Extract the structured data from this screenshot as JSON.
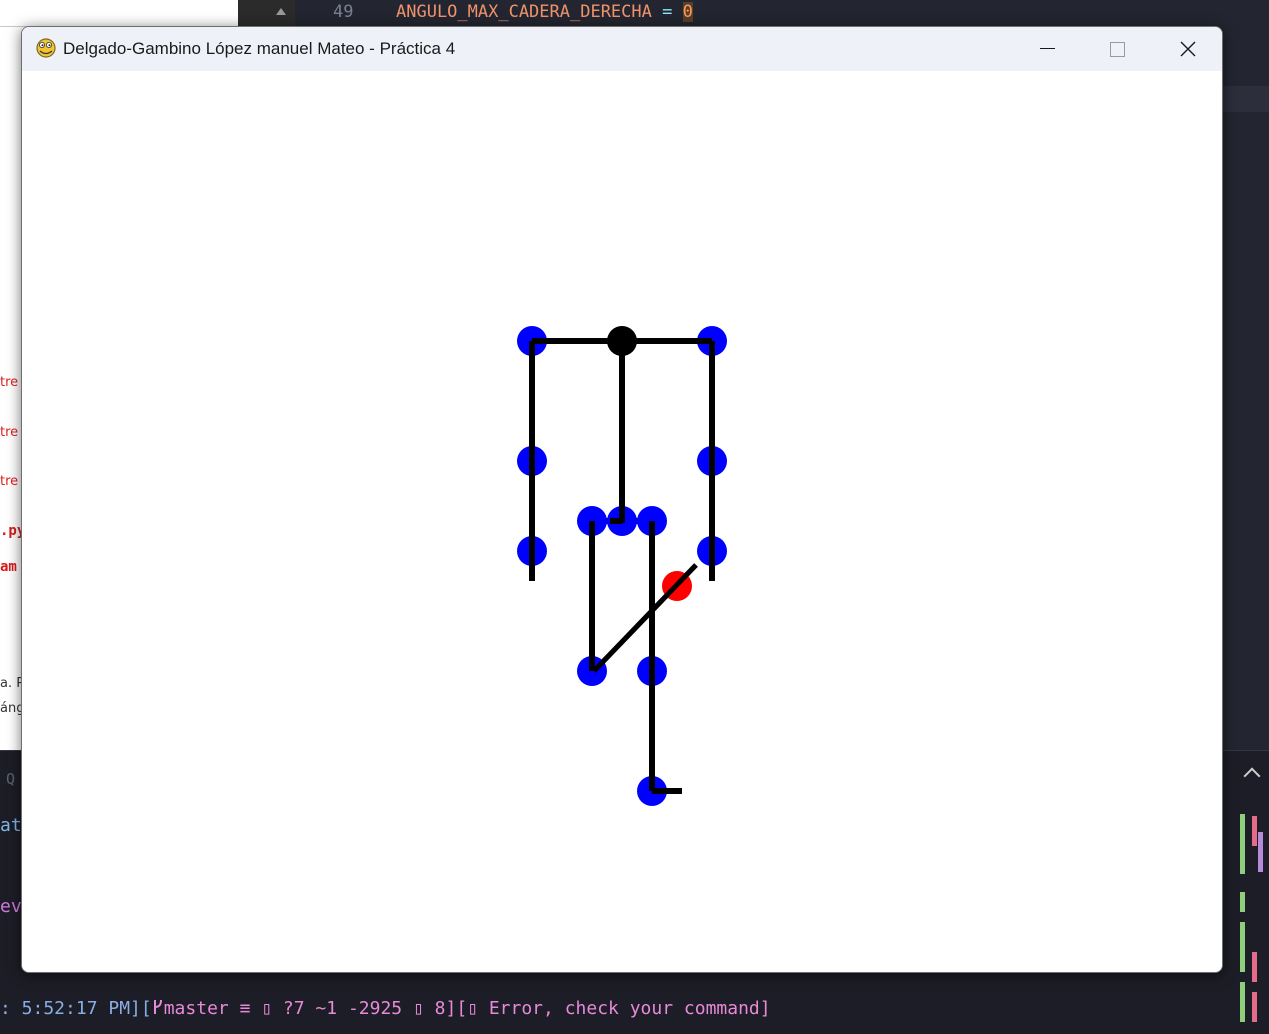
{
  "editor": {
    "line_number": "49",
    "code_identifier": "ANGULO_MAX_CADERA_DERECHA",
    "code_operator": "=",
    "code_value": "0"
  },
  "left_panel": {
    "frag_1": "tre",
    "frag_2": "tre",
    "frag_3": "tre",
    "frag_4": ".py",
    "frag_5": "am",
    "frag_6": "a. P",
    "frag_7": "áng"
  },
  "terminal": {
    "frag_q": "Q",
    "frag_at": "at",
    "frag_eva": "eva",
    "status_time": ": 5:52:17 PM][",
    "status_branch": "master ≡ ▯ ?7 ~1 -2925 ▯ 8][▯",
    "status_error": " Error, check your command]",
    "status_icon_box": "▯"
  },
  "window": {
    "title": "Delgado-Gambino López manuel Mateo - Práctica 4",
    "app_icon": "pygame-snake-icon",
    "minimize_icon": "minimize-icon",
    "maximize_icon": "maximize-icon",
    "close_icon": "close-icon"
  },
  "figure": {
    "colors": {
      "joint": "#0000ff",
      "center_joint": "#000000",
      "highlight_joint": "#ff0000",
      "bone": "#000000"
    }
  }
}
